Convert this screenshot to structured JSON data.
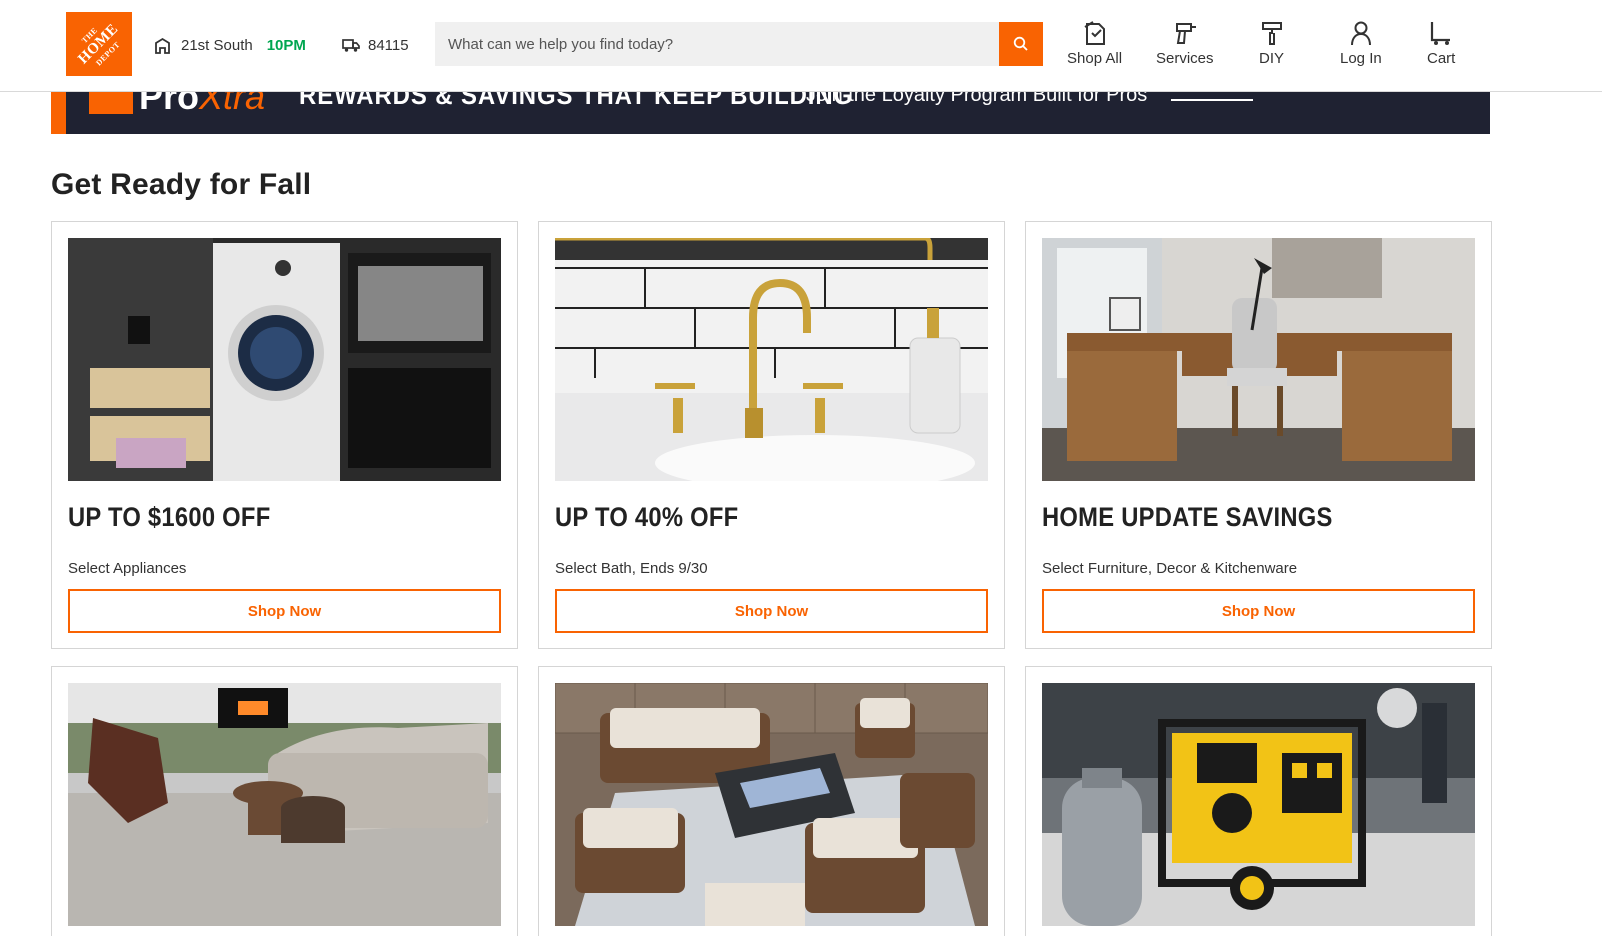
{
  "header": {
    "logo_alt": "THE HOME DEPOT",
    "store_name": "21st South",
    "store_hours": "10PM",
    "zip": "84115",
    "search_placeholder": "What can we help you find today?",
    "nav": [
      {
        "label": "Shop All",
        "icon": "catalog-icon"
      },
      {
        "label": "Services",
        "icon": "drill-icon"
      },
      {
        "label": "DIY",
        "icon": "paint-roller-icon"
      },
      {
        "label": "Log In",
        "icon": "user-icon"
      },
      {
        "label": "Cart",
        "icon": "cart-icon"
      }
    ]
  },
  "banner": {
    "brand": "Pro",
    "brand_accent": "Xtra",
    "headline": "REWARDS & SAVINGS THAT KEEP BUILDING",
    "subline": "Join the Loyalty Program Built for Pros"
  },
  "section": {
    "title": "Get Ready for Fall"
  },
  "cards": [
    {
      "title": "UP TO $1600 OFF",
      "subtitle": "Select Appliances",
      "cta": "Shop Now",
      "image": "laundry-room-photo"
    },
    {
      "title": "UP TO 40% OFF",
      "subtitle": "Select Bath, Ends 9/30",
      "cta": "Shop Now",
      "image": "gold-faucet-photo"
    },
    {
      "title": "HOME UPDATE SAVINGS",
      "subtitle": "Select Furniture, Decor & Kitchenware",
      "cta": "Shop Now",
      "image": "wood-desk-photo"
    },
    {
      "title": "",
      "subtitle": "",
      "cta": "",
      "image": "living-room-flooring-photo"
    },
    {
      "title": "",
      "subtitle": "",
      "cta": "",
      "image": "patio-wicker-set-photo"
    },
    {
      "title": "",
      "subtitle": "",
      "cta": "",
      "image": "portable-generator-photo"
    }
  ],
  "colors": {
    "brand_orange": "#f96302",
    "store_open_green": "#00a650",
    "banner_navy": "#1f2232"
  }
}
